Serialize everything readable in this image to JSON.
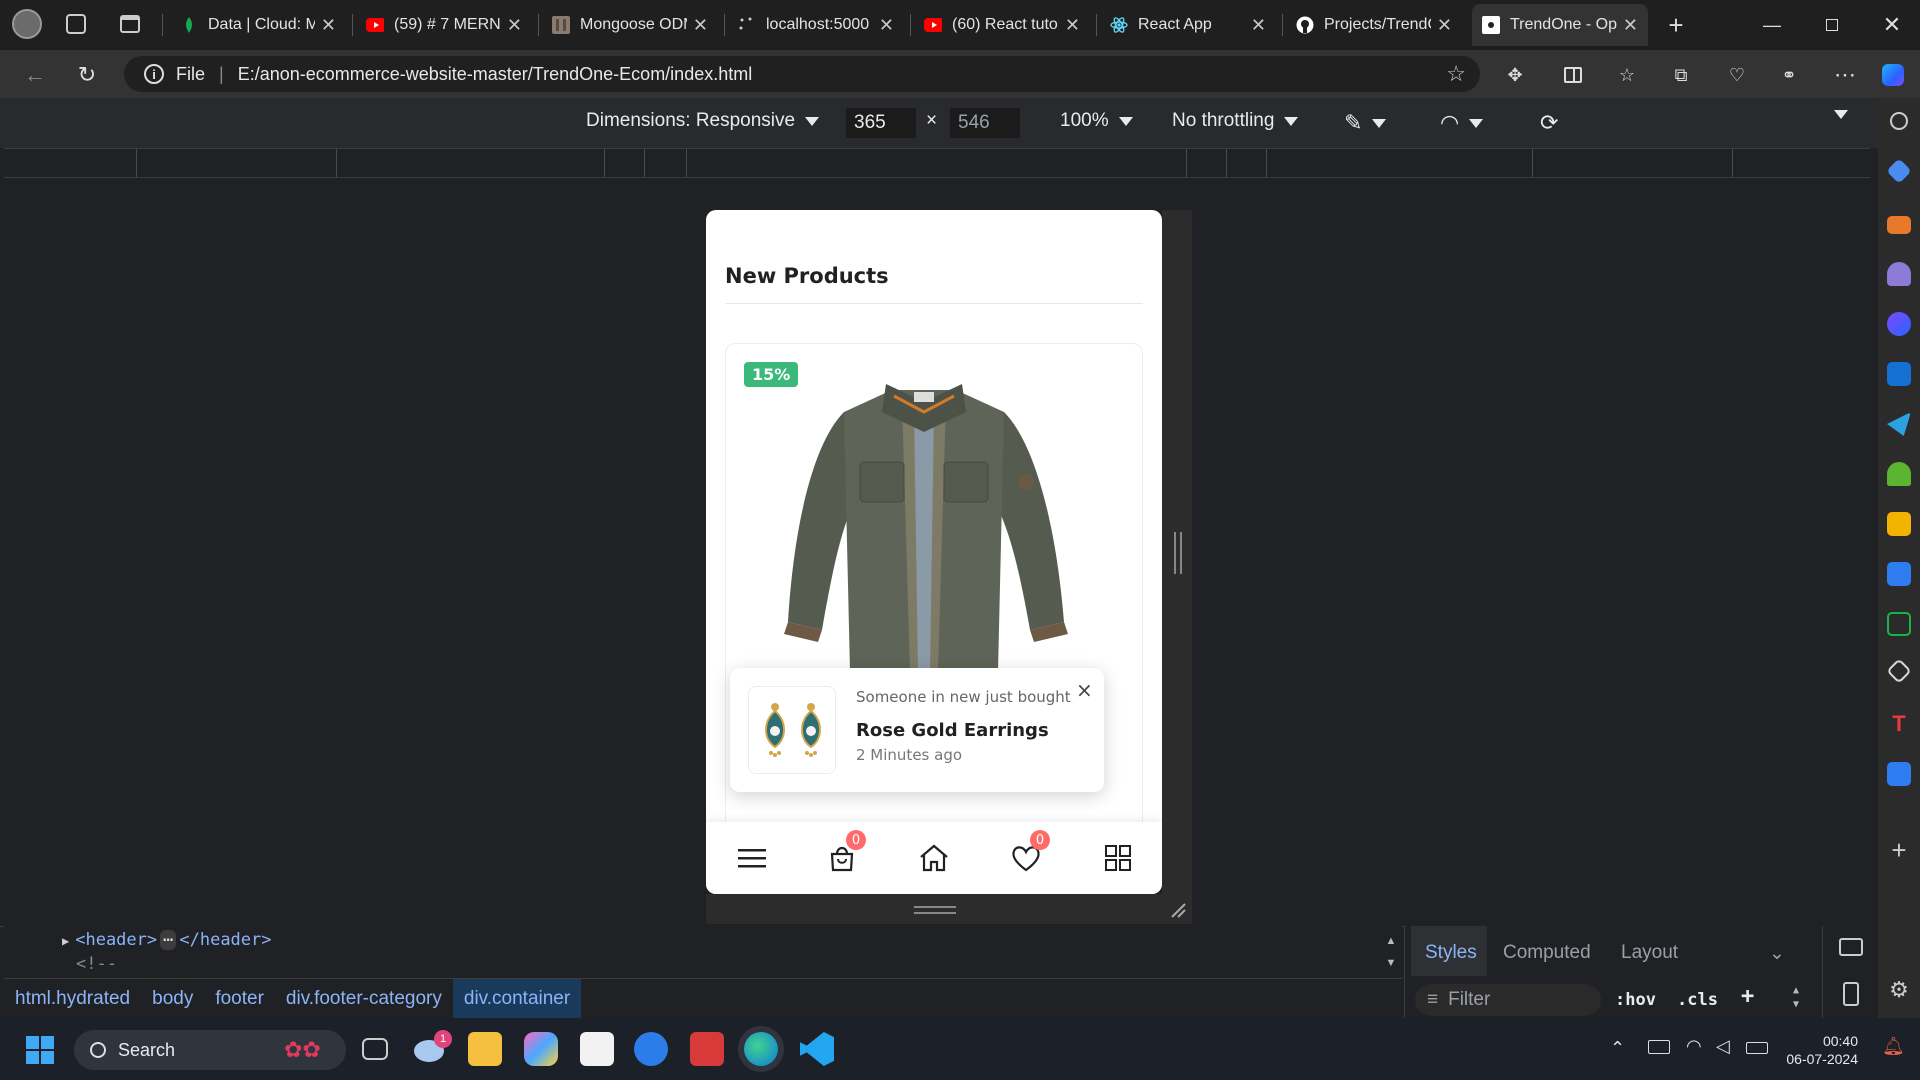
{
  "tabs": [
    {
      "label": "Data | Cloud: M",
      "icon": "mongodb-leaf-icon",
      "active": false
    },
    {
      "label": "(59) # 7 MERN",
      "icon": "youtube-icon",
      "active": false
    },
    {
      "label": "Mongoose ODM",
      "icon": "mongoose-icon",
      "active": false
    },
    {
      "label": "localhost:5000",
      "icon": "loading-icon",
      "active": false
    },
    {
      "label": "(60) React tutor",
      "icon": "youtube-icon",
      "active": false
    },
    {
      "label": "React App",
      "icon": "react-icon",
      "active": false
    },
    {
      "label": "Projects/TrendC",
      "icon": "github-icon",
      "active": false
    },
    {
      "label": "TrendOne - Op",
      "icon": "trendone-icon",
      "active": true
    }
  ],
  "address": {
    "scheme_label": "File",
    "url": "E:/anon-ecommerce-website-master/TrendOne-Ecom/index.html"
  },
  "device_toolbar": {
    "dimensions_label": "Dimensions: Responsive",
    "width": "365",
    "height": "546",
    "times": "×",
    "zoom": "100%",
    "throttling": "No throttling"
  },
  "page": {
    "section_title": "New Products",
    "product": {
      "discount_badge": "15%",
      "stars": "★★★☆☆"
    },
    "toast": {
      "subtitle": "Someone in new just bought",
      "title": "Rose Gold Earrings",
      "time": "2 Minutes ago",
      "close": "×"
    },
    "bottom_nav": {
      "cart_count": "0",
      "wishlist_count": "0"
    }
  },
  "devtools": {
    "elements": {
      "line1_open": "<header>",
      "line1_ellipsis": "⋯",
      "line1_close": "</header>",
      "line2": "<!--"
    },
    "breadcrumbs": [
      "html.hydrated",
      "body",
      "footer",
      "div.footer-category",
      "div.container"
    ],
    "styles_tabs": [
      "Styles",
      "Computed",
      "Layout"
    ],
    "filter_placeholder": "Filter",
    "hov": ":hov",
    "cls": ".cls"
  },
  "taskbar": {
    "search_placeholder": "Search",
    "weather_badge": "1",
    "time": "00:40",
    "date": "06-07-2024"
  }
}
